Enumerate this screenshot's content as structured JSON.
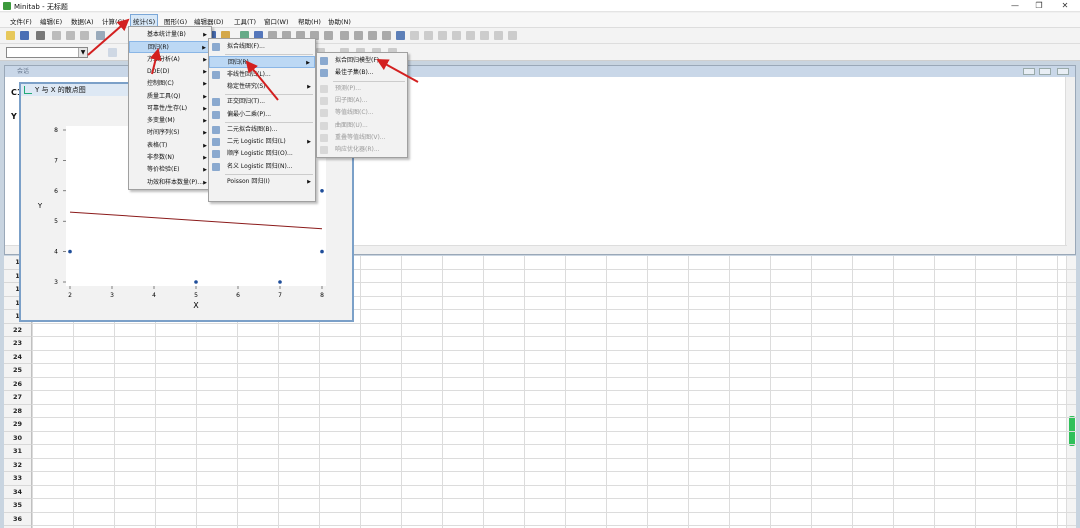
{
  "window": {
    "title": "Minitab - 无标题"
  },
  "menubar": [
    {
      "label": "文件(F)"
    },
    {
      "label": "编辑(E)"
    },
    {
      "label": "数据(A)"
    },
    {
      "label": "计算(C)"
    },
    {
      "label": "统计(S)"
    },
    {
      "label": "图形(G)"
    },
    {
      "label": "编辑器(D)"
    },
    {
      "label": "工具(T)"
    },
    {
      "label": "窗口(W)"
    },
    {
      "label": "帮助(H)"
    },
    {
      "label": "协助(N)"
    }
  ],
  "session": {
    "title": "会话",
    "line1": "C1",
    "line2": "Y"
  },
  "sheet": {
    "rows": [
      "1",
      "1",
      "1",
      "1",
      "1",
      "22",
      "23",
      "24",
      "25",
      "26",
      "27",
      "28",
      "29",
      "30",
      "31",
      "32",
      "33",
      "34",
      "35",
      "36",
      "37"
    ]
  },
  "graph": {
    "title": "Y 与 X 的散点图",
    "xlabel": "X",
    "ylabel": "Y",
    "xticks": [
      "2",
      "3",
      "4",
      "5",
      "6",
      "7",
      "8"
    ],
    "yticks": [
      "3",
      "4",
      "5",
      "6",
      "7",
      "8"
    ]
  },
  "chart_data": {
    "type": "scatter",
    "title": "Y 与 X 的散点图",
    "xlabel": "X",
    "ylabel": "Y",
    "xlim": [
      2,
      8
    ],
    "ylim": [
      3,
      8
    ],
    "points": [
      {
        "x": 2,
        "y": 4
      },
      {
        "x": 5,
        "y": 3
      },
      {
        "x": 7,
        "y": 3
      },
      {
        "x": 8,
        "y": 4
      },
      {
        "x": 8,
        "y": 6
      }
    ],
    "fit_line": {
      "x": [
        2,
        8
      ],
      "y": [
        5.3,
        4.75
      ]
    },
    "colors": {
      "points": "#1f4e9a",
      "fit_line": "#8b1a1a"
    }
  },
  "stat_menu": {
    "items": [
      {
        "label": "基本统计量(B)",
        "submenu": true
      },
      {
        "label": "回归(R)",
        "submenu": true,
        "highlight": true
      },
      {
        "label": "方差分析(A)",
        "submenu": true
      },
      {
        "label": "DOE(D)",
        "submenu": true
      },
      {
        "label": "控制图(C)",
        "submenu": true
      },
      {
        "label": "质量工具(Q)",
        "submenu": true
      },
      {
        "label": "可靠性/生存(L)",
        "submenu": true
      },
      {
        "label": "多变量(M)",
        "submenu": true
      },
      {
        "label": "时间序列(S)",
        "submenu": true
      },
      {
        "label": "表格(T)",
        "submenu": true
      },
      {
        "label": "非参数(N)",
        "submenu": true
      },
      {
        "label": "等价检验(E)",
        "submenu": true
      },
      {
        "label": "功效和样本数量(P)...",
        "submenu": true
      }
    ]
  },
  "regression_menu": {
    "items": [
      {
        "label": "拟合线图(F)...",
        "submenu": false,
        "icon": "fitted-line-icon"
      },
      {
        "label": "回归(R)",
        "submenu": true,
        "highlight": true,
        "icon": ""
      },
      {
        "label": "非线性回归(L)...",
        "submenu": false,
        "icon": "nonlinear-icon"
      },
      {
        "label": "稳定性研究(S)",
        "submenu": true,
        "icon": ""
      },
      {
        "label": "正交回归(T)...",
        "submenu": false,
        "icon": "orthogonal-icon"
      },
      {
        "label": "偏最小二乘(P)...",
        "submenu": false,
        "icon": "pls-icon"
      },
      {
        "label": "二元拟合线图(B)...",
        "submenu": false,
        "icon": "binary-fit-icon"
      },
      {
        "label": "二元 Logistic 回归(L)",
        "submenu": true,
        "icon": "binary-logistic-icon"
      },
      {
        "label": "顺序 Logistic 回归(O)...",
        "submenu": false,
        "icon": "ordinal-logistic-icon"
      },
      {
        "label": "名义 Logistic 回归(N)...",
        "submenu": false,
        "icon": "nominal-logistic-icon"
      },
      {
        "label": "Poisson 回归(I)",
        "submenu": true,
        "icon": ""
      }
    ]
  },
  "regression_sub": {
    "items": [
      {
        "label": "拟合回归模型(F)...",
        "disabled": false,
        "icon": "fit-model-icon"
      },
      {
        "label": "最佳子集(B)...",
        "disabled": false,
        "icon": "best-subsets-icon"
      },
      {
        "label": "预测(P)...",
        "disabled": true,
        "icon": "predict-icon"
      },
      {
        "label": "因子图(A)...",
        "disabled": true,
        "icon": "factorial-plot-icon"
      },
      {
        "label": "等值线图(C)...",
        "disabled": true,
        "icon": "contour-icon"
      },
      {
        "label": "曲面图(U)...",
        "disabled": true,
        "icon": "surface-icon"
      },
      {
        "label": "重叠等值线图(V)...",
        "disabled": true,
        "icon": "overlaid-contour-icon"
      },
      {
        "label": "响应优化器(R)...",
        "disabled": true,
        "icon": "optimizer-icon"
      }
    ]
  }
}
